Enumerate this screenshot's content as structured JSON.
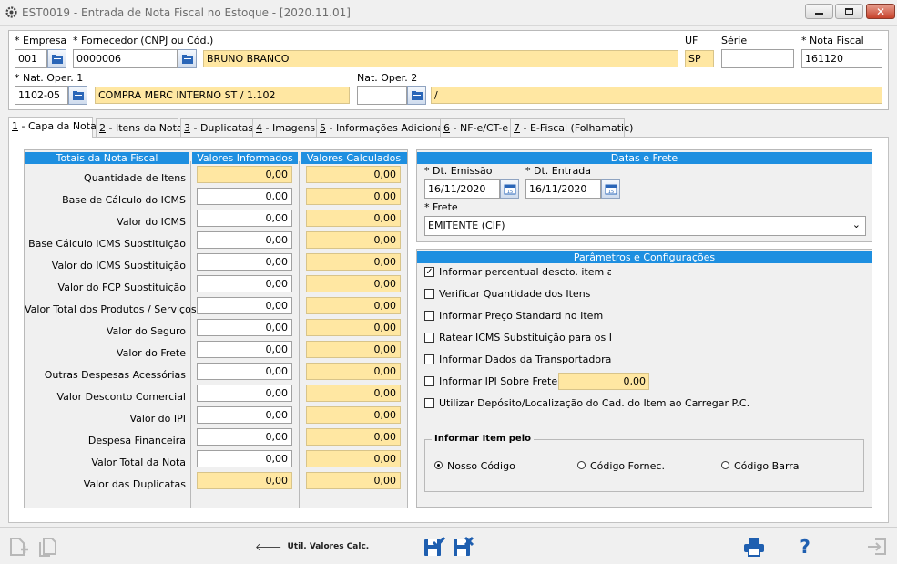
{
  "window": {
    "title": "EST0019 - Entrada de Nota Fiscal no Estoque - [2020.11.01]",
    "colors": {
      "accent": "#1e8fe0",
      "highlight": "#ffe7a2",
      "toolbar_icon": "#1f5fb0"
    }
  },
  "header": {
    "empresa_label": "Empresa",
    "empresa_value": "001",
    "fornecedor_label": "Fornecedor (CNPJ ou Cód.)",
    "fornecedor_code": "0000006",
    "fornecedor_name": "BRUNO BRANCO",
    "uf_label": "UF",
    "uf_value": "SP",
    "serie_label": "Série",
    "serie_value": "",
    "nota_label": "Nota Fiscal",
    "nota_value": "161120",
    "natop1_label": "Nat. Oper. 1",
    "natop1_code": "1102-05",
    "natop1_desc": "COMPRA MERC INTERNO ST / 1.102",
    "natop2_label": "Nat. Oper. 2",
    "natop2_code": "",
    "natop2_desc": "/"
  },
  "tabs": [
    {
      "num": "1",
      "label": " - Capa da Nota"
    },
    {
      "num": "2",
      "label": " - Itens da Nota"
    },
    {
      "num": "3",
      "label": " - Duplicatas"
    },
    {
      "num": "4",
      "label": " - Imagens"
    },
    {
      "num": "5",
      "label": " - Informações Adicionais"
    },
    {
      "num": "6",
      "label": " - NF-e/CT-e"
    },
    {
      "num": "7",
      "label": " - E-Fiscal (Folhamatic)"
    }
  ],
  "totals": {
    "header_label": "Totais da Nota Fiscal",
    "header_informed": "Valores Informados",
    "header_calculated": "Valores Calculados",
    "rows": [
      {
        "label": "Quantidade de Itens",
        "informed": "0,00",
        "calculated": "0,00"
      },
      {
        "label": "Base de Cálculo do ICMS",
        "informed": "0,00",
        "calculated": "0,00"
      },
      {
        "label": "Valor do ICMS",
        "informed": "0,00",
        "calculated": "0,00"
      },
      {
        "label": "Base Cálculo ICMS Substituição",
        "informed": "0,00",
        "calculated": "0,00"
      },
      {
        "label": "Valor do ICMS Substituição",
        "informed": "0,00",
        "calculated": "0,00"
      },
      {
        "label": "Valor do FCP Substituição",
        "informed": "0,00",
        "calculated": "0,00"
      },
      {
        "label": "Valor Total dos Produtos / Serviços",
        "informed": "0,00",
        "calculated": "0,00"
      },
      {
        "label": "Valor do Seguro",
        "informed": "0,00",
        "calculated": "0,00"
      },
      {
        "label": "Valor do Frete",
        "informed": "0,00",
        "calculated": "0,00"
      },
      {
        "label": "Outras Despesas Acessórias",
        "informed": "0,00",
        "calculated": "0,00"
      },
      {
        "label": "Valor Desconto Comercial",
        "informed": "0,00",
        "calculated": "0,00"
      },
      {
        "label": "Valor do IPI",
        "informed": "0,00",
        "calculated": "0,00"
      },
      {
        "label": "Despesa Financeira",
        "informed": "0,00",
        "calculated": "0,00"
      },
      {
        "label": "Valor Total da Nota",
        "informed": "0,00",
        "calculated": "0,00"
      },
      {
        "label": "Valor das Duplicatas",
        "informed": "0,00",
        "calculated": "0,00"
      }
    ]
  },
  "dates": {
    "header": "Datas e Frete",
    "emissao_label": "Dt. Emissão",
    "emissao_value": "16/11/2020",
    "entrada_label": "Dt. Entrada",
    "entrada_value": "16/11/2020",
    "frete_label": "Frete",
    "frete_value": "EMITENTE (CIF)"
  },
  "params": {
    "header": "Parâmetros e Configurações",
    "options": [
      {
        "label": "Informar percentual descto. item a item",
        "checked": true
      },
      {
        "label": "Verificar Quantidade dos Itens",
        "checked": false
      },
      {
        "label": "Informar Preço Standard no Item",
        "checked": false
      },
      {
        "label": "Ratear ICMS Substituição para os Itens",
        "checked": false
      },
      {
        "label": "Informar Dados da Transportadora",
        "checked": false
      },
      {
        "label": "Informar IPI Sobre Frete:",
        "checked": false
      },
      {
        "label": "Utilizar Depósito/Localização do Cad. do Item ao Carregar P.C.",
        "checked": false
      }
    ],
    "ipi_frete_value": "0,00",
    "item_group_label": "Informar Item pelo",
    "item_options": [
      "Nosso Código",
      "Código Fornec.",
      "Código Barra"
    ],
    "item_selected": 0
  },
  "toolbar": {
    "util_label": "Util. Valores Calc."
  }
}
